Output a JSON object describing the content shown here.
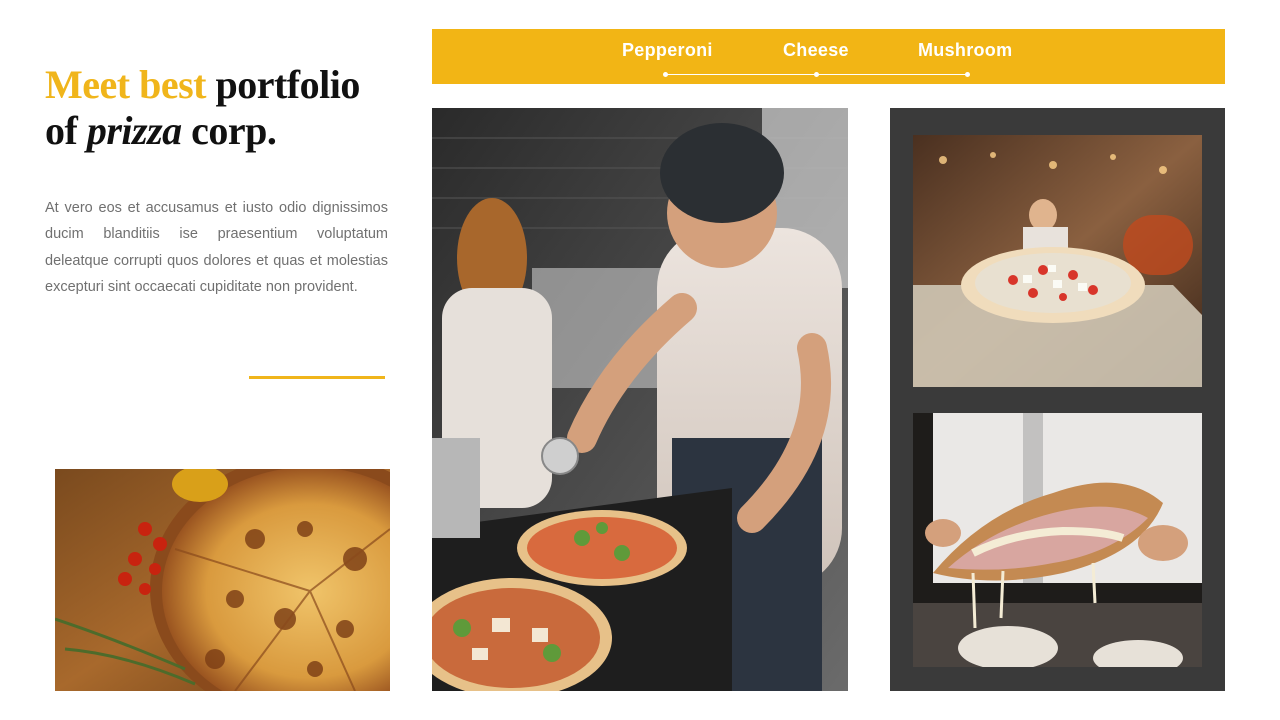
{
  "heading": {
    "accent": "Meet best",
    "rest1": " portfolio",
    "line2a": "of ",
    "italic": "prizza",
    "line2b": " corp."
  },
  "body_text": "At vero eos et accusamus et iusto odio dignissimos ducim blanditiis ise praesentium voluptatum deleatque corrupti quos dolores et quas et molestias excepturi sint occaecati cupiditate non provident.",
  "tabs": [
    {
      "label": "Pepperoni"
    },
    {
      "label": "Cheese"
    },
    {
      "label": "Mushroom"
    }
  ],
  "colors": {
    "accent": "#f2b515",
    "dark_panel": "#3a3a3a",
    "heading": "#111111",
    "body": "#707070"
  },
  "images": [
    {
      "icon": "pizza-on-wooden-board-photo"
    },
    {
      "icon": "chef-cutting-pizza-photo"
    },
    {
      "icon": "pizza-on-peel-photo"
    },
    {
      "icon": "cheesy-pizza-slice-photo"
    }
  ]
}
